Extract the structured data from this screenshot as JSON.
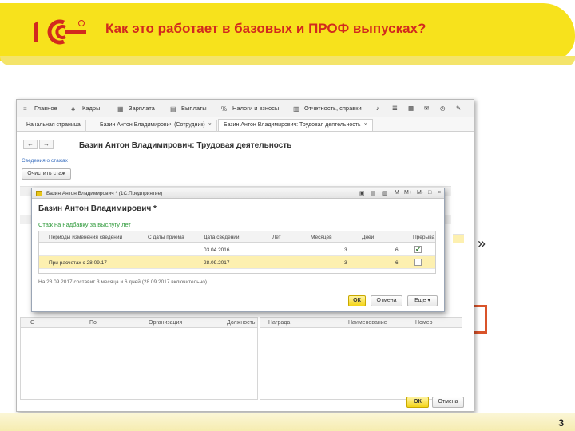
{
  "slide": {
    "title": "Как это работает в базовых и ПРОФ выпусках?",
    "page_number": "3",
    "peek_quote": "»",
    "brand_color": "#d22a1e",
    "accent_color": "#f7e21c"
  },
  "menu": {
    "items": [
      {
        "label": "Главное",
        "icon": "≡"
      },
      {
        "label": "Кадры",
        "icon": "♣"
      },
      {
        "label": "Зарплата",
        "icon": "▦"
      },
      {
        "label": "Выплаты",
        "icon": "▤"
      },
      {
        "label": "Налоги и взносы",
        "icon": "%"
      },
      {
        "label": "Отчетность, справки",
        "icon": "▥"
      }
    ],
    "tools": [
      "♪",
      "☰",
      "▦",
      "✉",
      "◷",
      "✎"
    ]
  },
  "tabs": [
    {
      "label": "Начальная страница"
    },
    {
      "label": "Базин Антон Владимирович (Сотрудник)"
    },
    {
      "label": "Базин Антон Владимирович: Трудовая деятельность"
    }
  ],
  "form": {
    "title": "Базин Антон Владимирович: Трудовая деятельность",
    "link_stazh": "Сведения о стажах",
    "clear_button": "Очистить стаж",
    "bottom_grid_left": [
      "С",
      "По",
      "Организация",
      "Должность"
    ],
    "bottom_grid_right": [
      "Награда",
      "Наименование",
      "Номер"
    ],
    "ok": "ОК",
    "cancel": "Отмена",
    "more": "Еще"
  },
  "dialog": {
    "window_title": "Базин Антон Владимирович * (1С:Предприятие)",
    "window_controls": [
      "▣",
      "▤",
      "▥",
      "M",
      "M+",
      "M-",
      "□",
      "×"
    ],
    "title": "Базин Антон Владимирович *",
    "subtitle": "Стаж на надбавку за выслугу лет",
    "columns": [
      "Периоды изменения сведений",
      "С даты приема",
      "Дата сведений",
      "Лет",
      "Месяцев",
      "Дней",
      "Прерыва"
    ],
    "rows": [
      {
        "period": "",
        "hire_date": "",
        "info_date": "03.04.2016",
        "years": "",
        "months": "3",
        "days": "6",
        "checked": true
      },
      {
        "period": "При расчетах с 28.09.17",
        "hire_date": "",
        "info_date": "28.09.2017",
        "years": "",
        "months": "3",
        "days": "6",
        "checked": false
      }
    ],
    "note": "На 28.09.2017 составит 3 месяца и 6 дней (28.09.2017 включительно)",
    "ok": "ОК",
    "cancel": "Отмена",
    "more": "Еще ▾"
  }
}
